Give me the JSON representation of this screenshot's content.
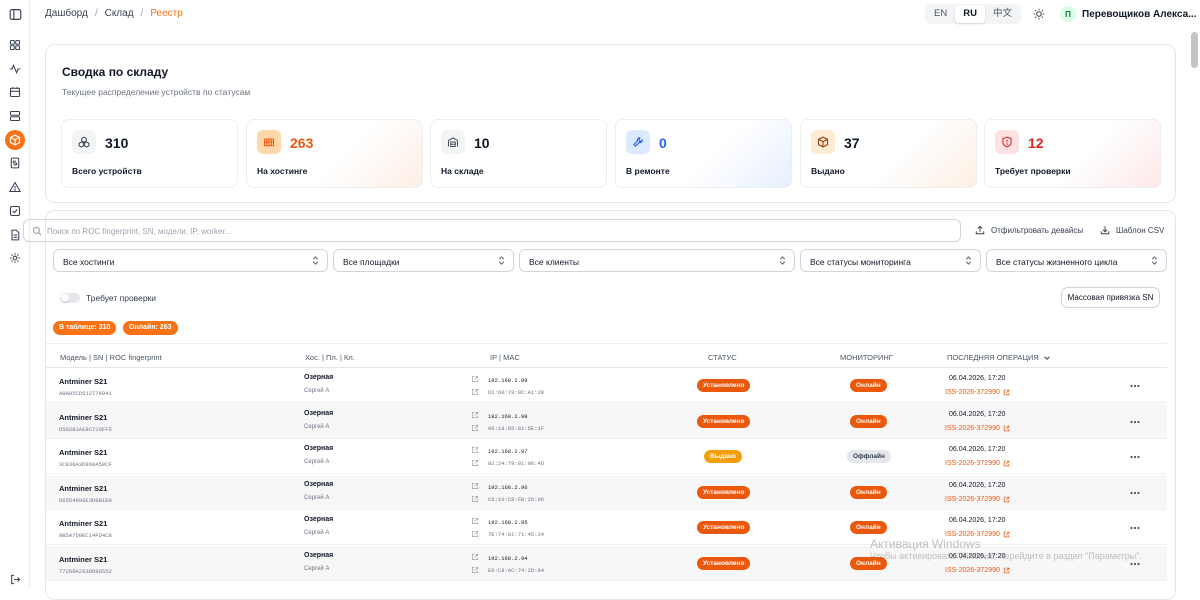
{
  "breadcrumb": {
    "items": [
      "Дашборд",
      "Склад"
    ],
    "current": "Реестр",
    "separator": "/"
  },
  "languages": [
    {
      "code": "EN",
      "active": false
    },
    {
      "code": "RU",
      "active": true
    },
    {
      "code": "中文",
      "active": false
    }
  ],
  "user": {
    "initial": "П",
    "name": "Перевощиков Алекса..."
  },
  "summary": {
    "title": "Сводка по складу",
    "subtitle": "Текущее распределение устройств по статусам",
    "stats": [
      {
        "value": "310",
        "label": "Всего устройств",
        "color": "#111827",
        "icon": "cube-cluster-icon"
      },
      {
        "value": "263",
        "label": "На хостинге",
        "color": "#ea580c",
        "icon": "server-icon"
      },
      {
        "value": "10",
        "label": "На складе",
        "color": "#111827",
        "icon": "warehouse-icon"
      },
      {
        "value": "0",
        "label": "В ремонте",
        "color": "#2563eb",
        "icon": "wrench-icon"
      },
      {
        "value": "37",
        "label": "Выдано",
        "color": "#111827",
        "icon": "package-icon"
      },
      {
        "value": "12",
        "label": "Требует проверки",
        "color": "#dc2626",
        "icon": "shield-alert-icon"
      }
    ]
  },
  "filters": {
    "search_placeholder": "Поиск по ROC fingerprint, SN, модели, IP, worker...",
    "filter_devices_label": "Отфильтровать девайсы",
    "csv_template_label": "Шаблон CSV",
    "selects": [
      "Все хостинги",
      "Все площадки",
      "Все клиенты",
      "Все статусы мониторинга",
      "Все статусы жизненного цикла"
    ],
    "needs_check_label": "Требует проверки",
    "mass_bind_label": "Массовая привязка SN",
    "pills": [
      "В таблице: 310",
      "Онлайн: 263"
    ]
  },
  "table": {
    "headers": [
      "Модель | SN | ROC fingerprint",
      "Хос. | Пл. | Кл.",
      "IP | MAC",
      "СТАТУС",
      "МОНИТОРИНГ",
      "ПОСЛЕДНЯЯ ОПЕРАЦИЯ"
    ],
    "rows": [
      {
        "model": "Antminer S21",
        "sn": "A8A85CD512776941",
        "location": "Озерная",
        "client": "Сергей А",
        "ip": "192.168.2.99",
        "mac": "D2:60:78:0C:A1:28",
        "status": "Установлено",
        "monitoring": "Онлайн",
        "date": "06.04.2026, 17:20",
        "issue": "ISS-2026-372990"
      },
      {
        "model": "Antminer S21",
        "sn": "D58281AE8C716FF5",
        "location": "Озерная",
        "client": "Сергей А",
        "ip": "192.168.2.98",
        "mac": "06:18:85:81:5E:1F",
        "status": "Установлено",
        "monitoring": "Онлайн",
        "date": "06.04.2026, 17:20",
        "issue": "ISS-2026-372990"
      },
      {
        "model": "Antminer S21",
        "sn": "3C838A3D860A50CF",
        "location": "Озерная",
        "client": "Сергей А",
        "ip": "192.168.2.97",
        "mac": "82:24:79:01:06:4D",
        "status": "Выдано",
        "monitoring": "Оффлайн",
        "date": "06.04.2026, 17:20",
        "issue": "ISS-2026-372990"
      },
      {
        "model": "Antminer S21",
        "sn": "D6554896E3D8B1E0",
        "location": "Озерная",
        "client": "Сергей А",
        "ip": "192.168.2.96",
        "mac": "C6:10:C8:FB:20:96",
        "status": "Установлено",
        "monitoring": "Онлайн",
        "date": "06.04.2026, 17:20",
        "issue": "ISS-2026-372990"
      },
      {
        "model": "Antminer S21",
        "sn": "8B5A7D9EC14FD4C8",
        "location": "Озерная",
        "client": "Сергей А",
        "ip": "192.168.2.95",
        "mac": "7E:74:81:71:45:34",
        "status": "Установлено",
        "monitoring": "Онлайн",
        "date": "06.04.2026, 17:20",
        "issue": "ISS-2026-372990"
      },
      {
        "model": "Antminer S21",
        "sn": "77268A2638D98552",
        "location": "Озерная",
        "client": "Сергей А",
        "ip": "192.168.2.94",
        "mac": "E6:C8:AC:74:2D:84",
        "status": "Установлено",
        "monitoring": "Онлайн",
        "date": "06.04.2026, 17:20",
        "issue": "ISS-2026-372990"
      }
    ]
  },
  "watermark": {
    "line1": "Активация Windows",
    "line2": "Чтобы активировать Windows, перейдите в раздел \"Параметры\"."
  },
  "colors": {
    "accent": "#f97316",
    "status_installed": "#ea580c",
    "status_issued": "#f59e0b",
    "offline": "#e5e7eb"
  }
}
